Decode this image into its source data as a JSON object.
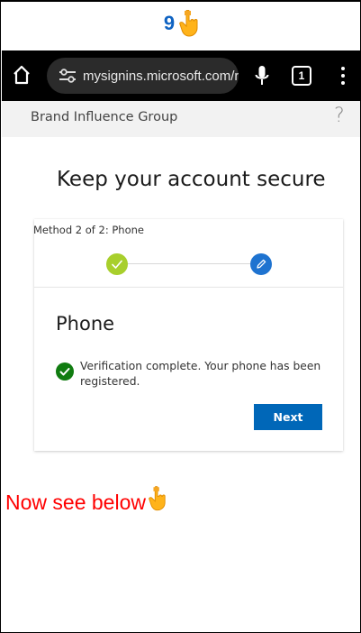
{
  "annotation": {
    "step_number": "9",
    "footer_text": "Now see below",
    "pointer_icon": "hand-point-down-icon"
  },
  "browser": {
    "url": "mysignins.microsoft.com/r",
    "tab_count": "1",
    "icons": [
      "home-icon",
      "site-settings-icon",
      "mic-icon",
      "tabs-icon",
      "menu-icon"
    ]
  },
  "header": {
    "org_name": "Brand Influence Group",
    "help": "?"
  },
  "page": {
    "title": "Keep your account secure"
  },
  "wizard": {
    "method_label": "Method 2 of 2: Phone",
    "steps": [
      {
        "status": "complete",
        "icon": "check-icon"
      },
      {
        "status": "current",
        "icon": "pencil-icon"
      }
    ],
    "section_title": "Phone",
    "success_message": "Verification complete. Your phone has been registered.",
    "next_label": "Next"
  },
  "colors": {
    "step_number": "#0f63c2",
    "footer_text": "#ff0000",
    "complete_step": "#a8cf2c",
    "current_step": "#1e73d0",
    "success_check": "#107c10",
    "primary_button": "#0067b8"
  }
}
